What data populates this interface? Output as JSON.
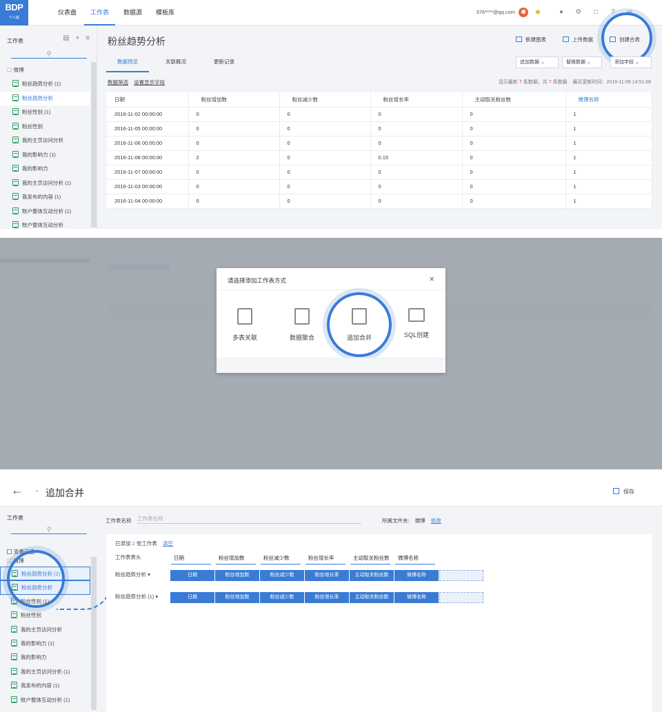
{
  "top_nav": {
    "logo_text": "BDP",
    "logo_sub": "个人版",
    "tabs": [
      "仪表盘",
      "工作表",
      "数据源",
      "模板库"
    ],
    "active_tab": "工作表",
    "user_email": "376****@qq.com",
    "icons": [
      "avatar-icon",
      "diamond-icon",
      "pin-icon",
      "gear-icon",
      "message-icon",
      "help-icon",
      "logout-icon"
    ]
  },
  "sidebar": {
    "title": "工作表",
    "folder": "微博",
    "items": [
      "粉丝趋势分析 (1)",
      "粉丝趋势分析",
      "粉丝性别 (1)",
      "粉丝性别",
      "我的主页访问分析",
      "我的影响力 (1)",
      "我的影响力",
      "我的主页访问分析 (1)",
      "我发布的内容 (1)",
      "账户整体互动分析 (1)",
      "账户整体互动分析"
    ],
    "selected_index": 1
  },
  "main": {
    "title": "粉丝趋势分析",
    "header_buttons": [
      "新建图表",
      "上传数据",
      "创建合表"
    ],
    "subtabs": [
      "数据预览",
      "关联概况",
      "更新记录"
    ],
    "active_subtab": "数据预览",
    "selects": [
      "追加数据",
      "替换数据",
      "添加字段"
    ],
    "filter_links": [
      "数据筛选",
      "设置显示字段"
    ],
    "info": {
      "prefix": "显示最新",
      "shown": "7",
      "mid": "条数据，共",
      "total": "7",
      "suffix": "条数据",
      "updated": "最近更新时间：2016-11-09 14:51:08"
    },
    "table": {
      "columns": [
        "日期",
        "粉丝增加数",
        "粉丝减少数",
        "粉丝增长率",
        "主动取关粉丝数",
        "微博名称"
      ],
      "rows": [
        [
          "2016-11-02 00:00:00",
          "0",
          "0",
          "0",
          "0",
          "1"
        ],
        [
          "2016-11-05 00:00:00",
          "0",
          "0",
          "0",
          "0",
          "1"
        ],
        [
          "2016-11-06 00:00:00",
          "0",
          "0",
          "0",
          "0",
          "1"
        ],
        [
          "2016-11-08 00:00:00",
          "2",
          "0",
          "0.15",
          "0",
          "1"
        ],
        [
          "2016-11-07 00:00:00",
          "0",
          "0",
          "0",
          "0",
          "1"
        ],
        [
          "2016-11-03 00:00:00",
          "0",
          "0",
          "0",
          "0",
          "1"
        ],
        [
          "2016-11-04 00:00:00",
          "0",
          "0",
          "0",
          "0",
          "1"
        ]
      ]
    }
  },
  "modal": {
    "title": "请选择添加工作表方式",
    "options": [
      "多表关联",
      "数据聚合",
      "追加合并",
      "SQL创建"
    ],
    "highlighted": "追加合并"
  },
  "append_page": {
    "title": "追加合并",
    "save_label": "保存",
    "sidebar_title": "工作表",
    "view_selected": "查看已选",
    "folder": "微博",
    "items": [
      "粉丝趋势分析 (1)",
      "粉丝趋势分析",
      "粉丝性别 (1)",
      "粉丝性别",
      "我的主页访问分析",
      "我的影响力 (1)",
      "我的影响力",
      "我的主页访问分析 (1)",
      "我发布的内容 (1)",
      "账户整体互动分析 (1)"
    ],
    "name_label": "工作表名称",
    "name_placeholder": "工作表名称",
    "folder_label": "所属文件夹:",
    "folder_value": "微博",
    "folder_edit": "修改",
    "added_prefix": "已添加",
    "added_count": "2",
    "added_suffix": "张工作表",
    "clear_label": "清空",
    "header_row_label": "工作表表头",
    "headers": [
      "日期",
      "粉丝增加数",
      "粉丝减少数",
      "粉丝增长率",
      "主动取关粉丝数",
      "微博名称"
    ],
    "sources": [
      {
        "label": "粉丝趋势分析",
        "fields": [
          "日期",
          "粉丝增加数",
          "粉丝减少数",
          "粉丝增长率",
          "主动取关粉丝数",
          "微博名称"
        ]
      },
      {
        "label": "粉丝趋势分析 (1)",
        "fields": [
          "日期",
          "粉丝增加数",
          "粉丝减少数",
          "粉丝增长率",
          "主动取关粉丝数",
          "微博名称"
        ]
      }
    ]
  },
  "colors": {
    "accent": "#3a7bd5",
    "highlight_red": "#e4393c"
  }
}
